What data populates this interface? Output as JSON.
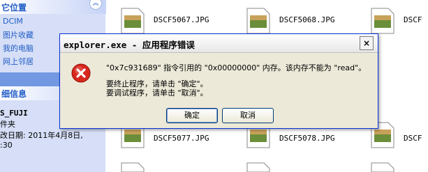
{
  "sidebar": {
    "other_places_header": "它位置",
    "links": [
      "DCIM",
      "图片收藏",
      "我的电脑",
      "网上邻居"
    ],
    "details_header": "细信息",
    "details": {
      "name": "S_FUJI",
      "type": "件夹",
      "modified": "改日期: 2011年4月8日,",
      "time": ":30"
    }
  },
  "files": [
    {
      "name": "DSCF5067.JPG"
    },
    {
      "name": "DSCF5068.JPG"
    },
    {
      "name": "DSCF"
    },
    {
      "name": "DSCF5077.JPG"
    },
    {
      "name": "DSCF5078.JPG"
    },
    {
      "name": "DSCF"
    }
  ],
  "dialog": {
    "title": "explorer.exe - 应用程序错误",
    "close_glyph": "×",
    "message_line1": "\"0x7c931689\" 指令引用的 \"0x00000000\" 内存。该内存不能为 \"read\"。",
    "message_line2": "要终止程序，请单击 \"确定\"。",
    "message_line3": "要调试程序，请单击 \"取消\"。",
    "ok_label": "确定",
    "cancel_label": "取消"
  },
  "colors": {
    "sidebar_link": "#215dc6",
    "error_red": "#d8261d",
    "dialog_bg": "#ece9d8"
  }
}
